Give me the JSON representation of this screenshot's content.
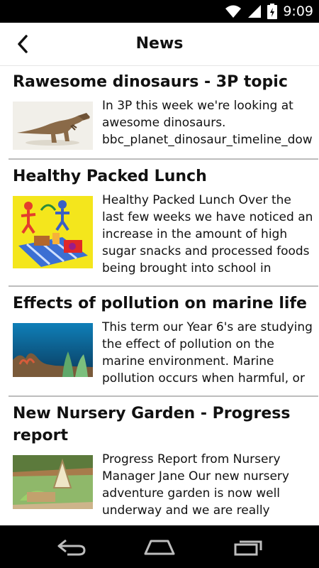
{
  "status_bar": {
    "time": "9:09",
    "icons": [
      "wifi-icon",
      "signal-icon",
      "battery-icon"
    ]
  },
  "header": {
    "title": "News",
    "back_icon": "chevron-left-icon"
  },
  "articles": [
    {
      "title": "Rawesome dinosaurs - 3P topic",
      "thumbnail": "dinosaur-image",
      "snippet": "In 3P this week we're looking at awesome dinosaurs.\nbbc_planet_dinosaur_timeline_dow"
    },
    {
      "title": "Healthy Packed Lunch",
      "thumbnail": "packed-lunch-image",
      "snippet": "Healthy Packed Lunch Over the last few weeks we have noticed an increase in the amount of high sugar snacks and processed foods being brought into school in packed"
    },
    {
      "title": "Effects of pollution on marine life",
      "thumbnail": "coral-reef-image",
      "snippet": "This term our Year 6's are studying the effect of pollution on the marine environment. Marine pollution occurs when harmful, or"
    },
    {
      "title": "New Nursery Garden - Progress report",
      "thumbnail": "nursery-garden-image",
      "snippet": "Progress Report from Nursery Manager Jane Our new nursery adventure garden is now well underway and we are really starting"
    }
  ],
  "nav_bar": {
    "buttons": [
      "back-nav-icon",
      "home-nav-icon",
      "recents-nav-icon"
    ]
  }
}
